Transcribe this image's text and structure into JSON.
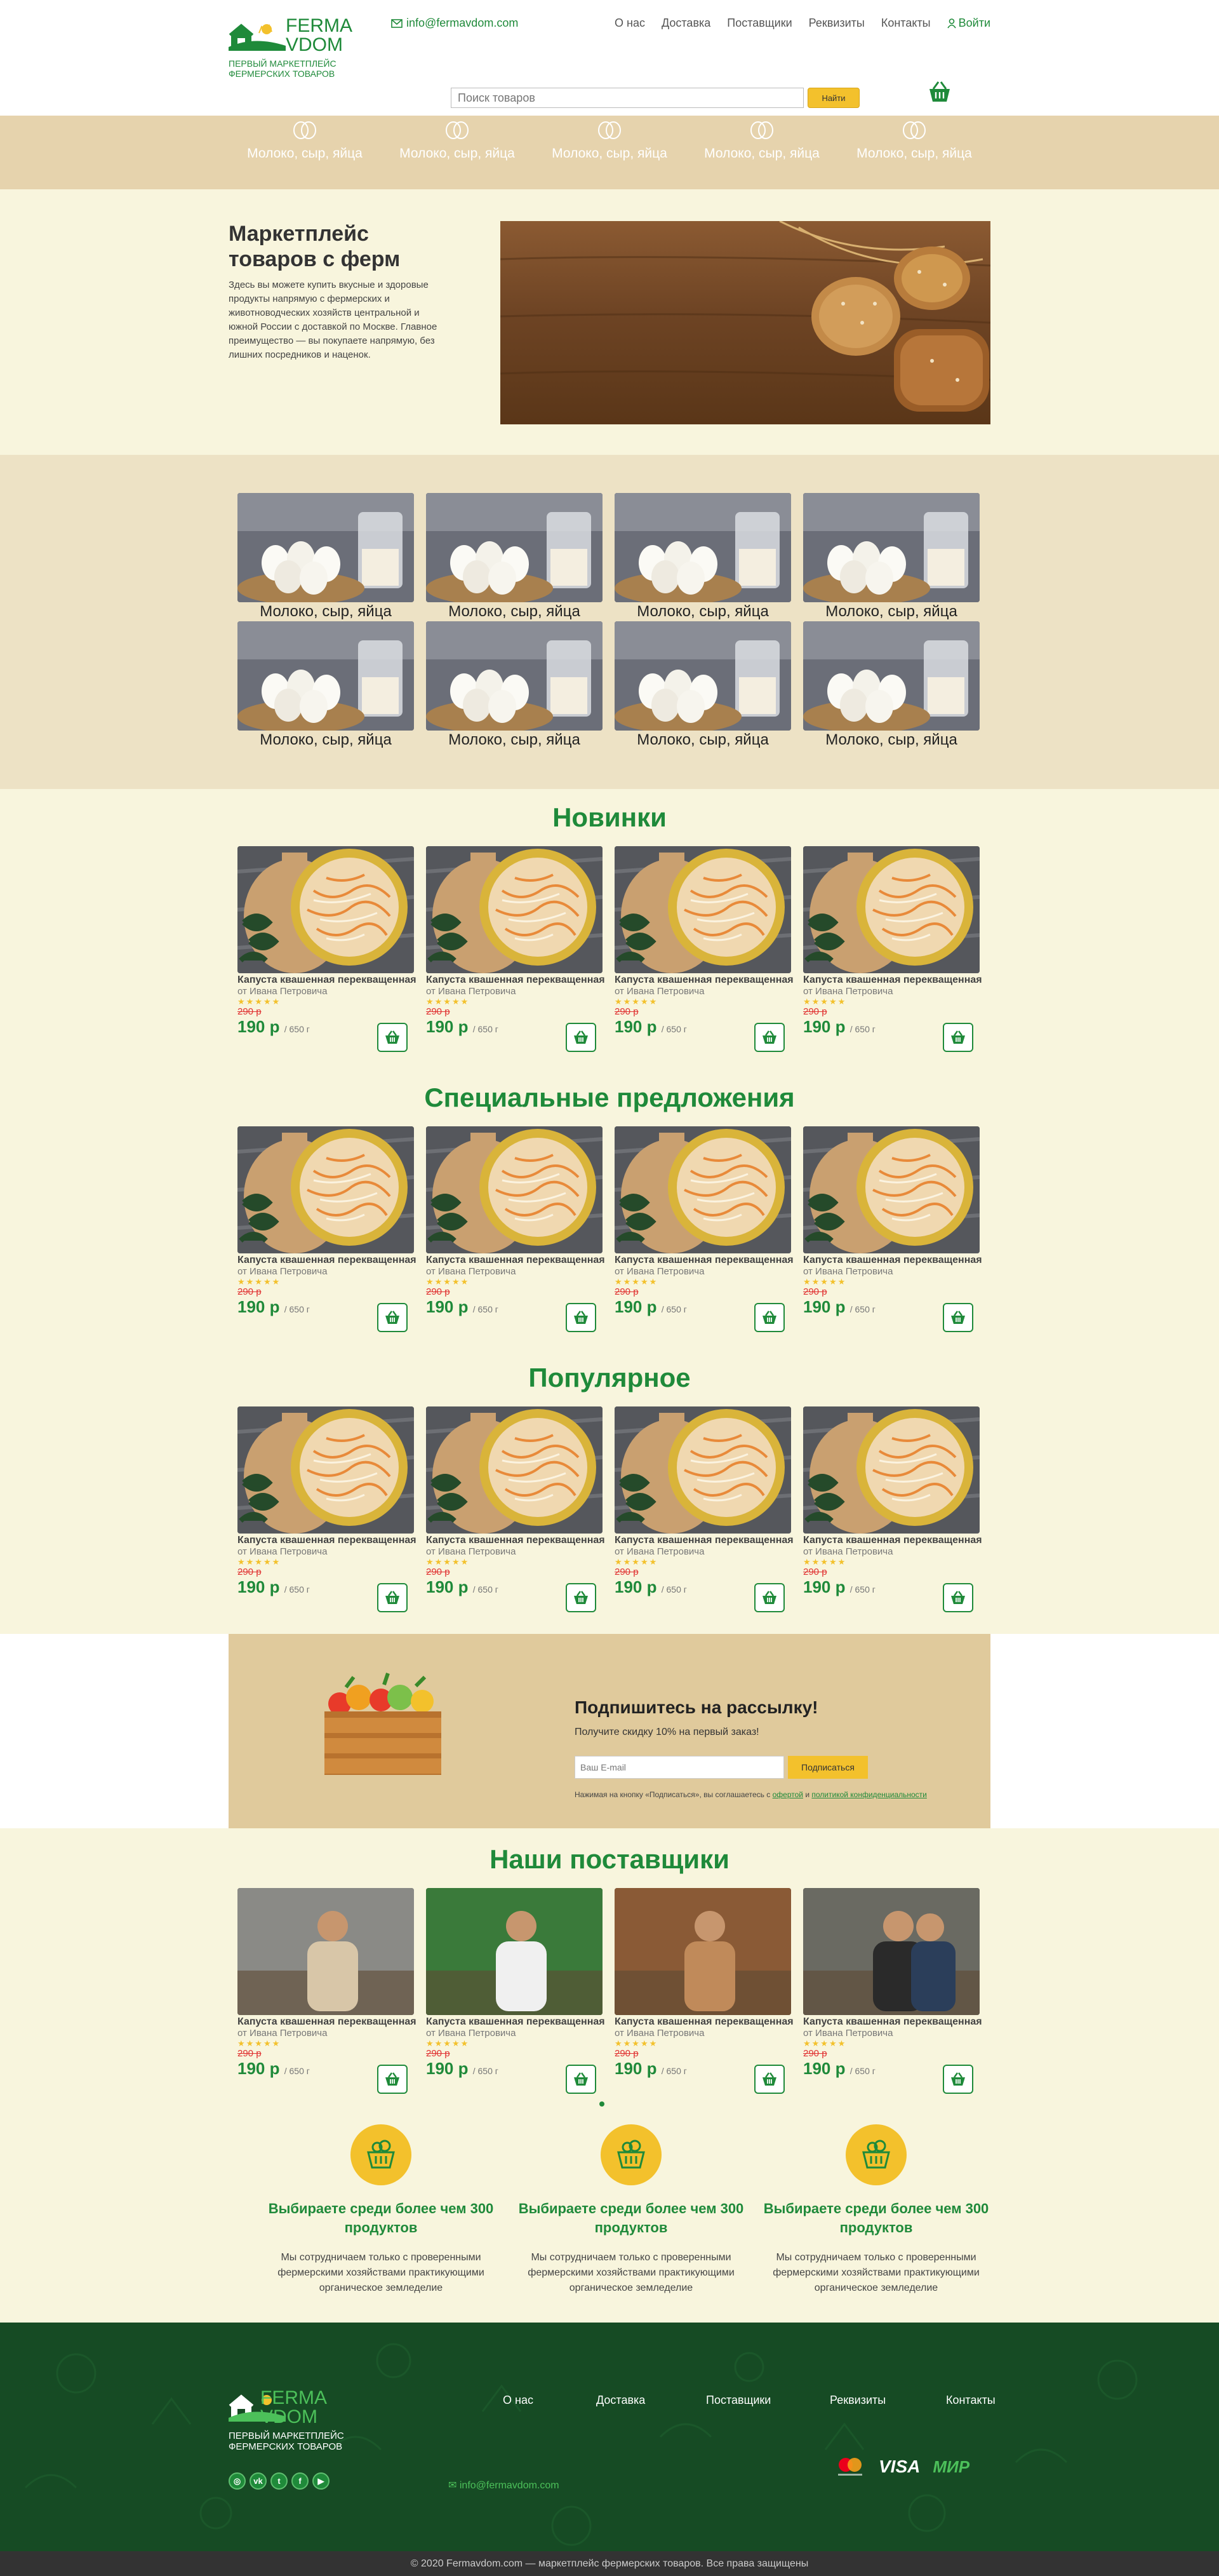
{
  "header": {
    "logo_line1": "FERMA",
    "logo_line2": "VDOM",
    "logo_sub": "ПЕРВЫЙ МАРКЕТПЛЕЙС ФЕРМЕРСКИХ ТОВАРОВ",
    "email": "info@fermavdom.com",
    "nav": [
      "О нас",
      "Доставка",
      "Поставщики",
      "Реквизиты",
      "Контакты"
    ],
    "login": "Войти",
    "search_placeholder": "Поиск товаров",
    "search_button": "Найти"
  },
  "category_band": [
    "Молоко, сыр, яйца",
    "Молоко, сыр, яйца",
    "Молоко, сыр, яйца",
    "Молоко, сыр, яйца",
    "Молоко, сыр, яйца"
  ],
  "hero": {
    "title": "Маркетплейс товаров с ферм",
    "text": "Здесь вы можете купить вкусные и здоровые продукты напрямую с фермерских и животноводческих хозяйств центральной и южной России с доставкой по Москве. Главное преимущество — вы покупаете напрямую, без лишних посредников и наценок."
  },
  "category_grid": [
    "Молоко, сыр, яйца",
    "Молоко, сыр, яйца",
    "Молоко, сыр, яйца",
    "Молоко, сыр, яйца",
    "Молоко, сыр, яйца",
    "Молоко, сыр, яйца",
    "Молоко, сыр, яйца",
    "Молоко, сыр, яйца"
  ],
  "product": {
    "name": "Капуста квашенная перекващенная",
    "from": "от Ивана Петровича",
    "stars": "★★★★★",
    "old_price": "290 р",
    "price": "190 р",
    "weight": "/ 650 г"
  },
  "sections": {
    "new": "Новинки",
    "special": "Специальные предложения",
    "popular": "Популярное",
    "suppliers": "Наши поставщики"
  },
  "newsletter": {
    "title": "Подпишитесь на рассылку!",
    "subtitle": "Получите скидку 10% на первый заказ!",
    "placeholder": "Ваш E-mail",
    "button": "Подписаться",
    "note_prefix": "Нажимая на кнопку «Подписаться», вы соглашаетесь с",
    "note_link1": "офертой",
    "note_and": "и",
    "note_link2": "политикой конфиденциальности"
  },
  "features": [
    {
      "title": "Выбираете среди более чем 300 продуктов",
      "text": "Мы сотрудничаем только с проверенными фермерскими хозяйствами практикующими органическое земледелие"
    },
    {
      "title": "Выбираете среди более чем 300 продуктов",
      "text": "Мы сотрудничаем только с проверенными фермерскими хозяйствами практикующими органическое земледелие"
    },
    {
      "title": "Выбираете среди более чем 300 продуктов",
      "text": "Мы сотрудничаем только с проверенными фермерскими хозяйствами практикующими органическое земледелие"
    }
  ],
  "footer": {
    "logo_line1": "FERMA",
    "logo_line2": "VDOM",
    "logo_sub": "ПЕРВЫЙ МАРКЕТПЛЕЙС ФЕРМЕРСКИХ ТОВАРОВ",
    "nav": [
      "О нас",
      "Доставка",
      "Поставщики",
      "Реквизиты",
      "Контакты"
    ],
    "email": "info@fermavdom.com",
    "social_icons": [
      "instagram-icon",
      "vk-icon",
      "twitter-icon",
      "facebook-icon",
      "youtube-icon"
    ],
    "payments": [
      "mastercard",
      "VISA",
      "МИР"
    ],
    "copyright": "© 2020 Fermavdom.com — маркетплейс фермерских товаров. Все права защищены"
  },
  "colors": {
    "green": "#1f8a3a",
    "yellow": "#f3c12c",
    "beige": "#e6d3ad",
    "cream": "#f8f5dd",
    "footer": "#164b24"
  }
}
